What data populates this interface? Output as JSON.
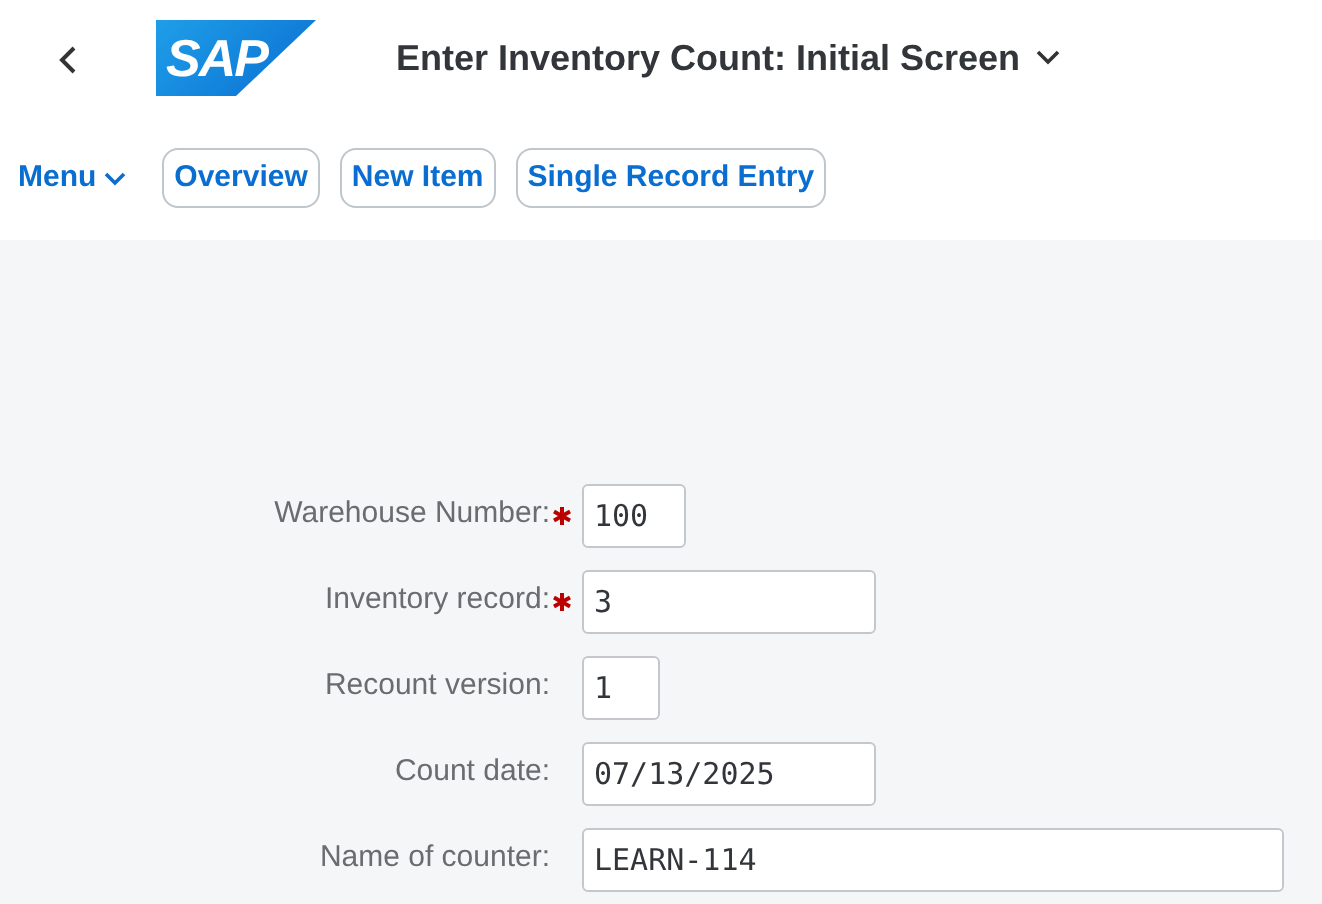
{
  "header": {
    "logo": "SAP",
    "title": "Enter Inventory Count: Initial Screen"
  },
  "toolbar": {
    "menu": "Menu",
    "buttons": [
      "Overview",
      "New Item",
      "Single Record Entry"
    ]
  },
  "form": {
    "fields": [
      {
        "label": "Warehouse Number:",
        "value": "100",
        "required": true,
        "kind": "short"
      },
      {
        "label": "Inventory record:",
        "value": "3",
        "required": true,
        "kind": "medium"
      },
      {
        "label": "Recount version:",
        "value": "1",
        "required": false,
        "kind": "tiny"
      },
      {
        "label": "Count date:",
        "value": "07/13/2025",
        "required": false,
        "kind": "medium"
      },
      {
        "label": "Name of counter:",
        "value": "LEARN-114",
        "required": false,
        "kind": "long"
      }
    ]
  }
}
